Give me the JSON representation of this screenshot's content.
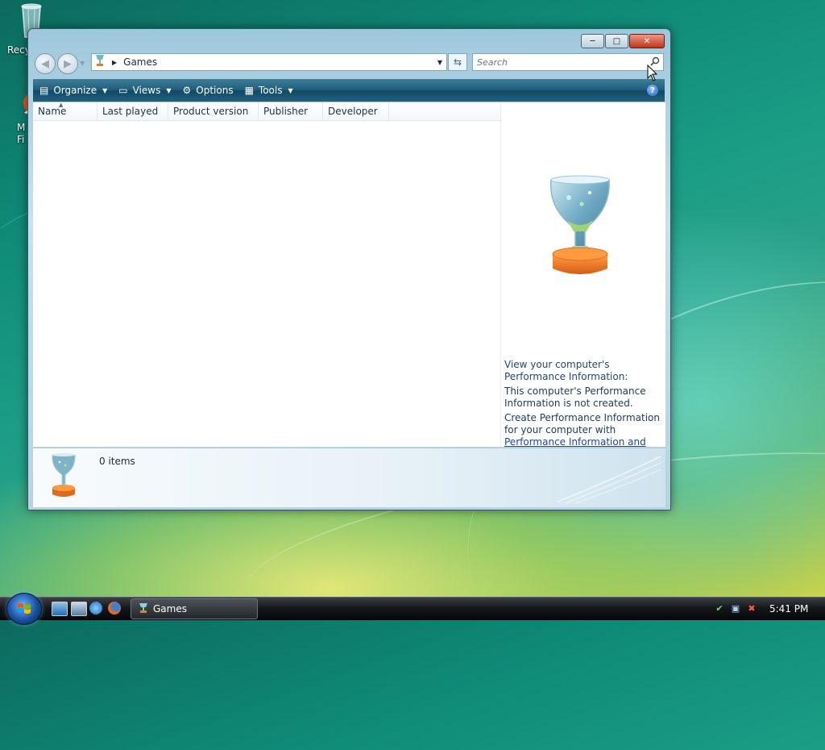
{
  "desktop": {
    "icons": [
      {
        "label": "Recy"
      },
      {
        "label": "M\nFi"
      }
    ]
  },
  "window": {
    "caption": {
      "minimize": "─",
      "maximize": "□",
      "close": "✕"
    },
    "address": {
      "location": "Games"
    },
    "search": {
      "placeholder": "Search"
    },
    "toolbar": {
      "organize": "Organize",
      "views": "Views",
      "options": "Options",
      "tools": "Tools",
      "help": "?"
    },
    "columns": [
      "Name",
      "Last played",
      "Product version",
      "Publisher",
      "Developer"
    ],
    "preview": {
      "title": "View your computer's Performance Information:",
      "status": "This computer's Performance Information is not created.",
      "action_text": "Create Performance Information for your computer with ",
      "action_link": "Performance Information and Tools",
      "action_end": "."
    },
    "details": {
      "count": "0 items"
    }
  },
  "taskbar": {
    "task": "Games",
    "clock": "5:41 PM"
  },
  "colors": {
    "toolbar": "#1e5b78",
    "link": "#1a44b8",
    "trophy_base": "#f07a20"
  }
}
